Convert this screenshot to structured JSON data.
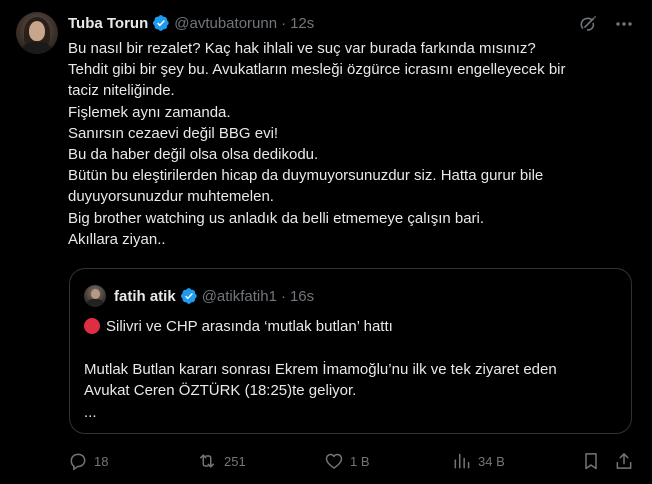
{
  "colors": {
    "background": "#000000",
    "text_primary": "#e7e9ea",
    "text_secondary": "#71767b",
    "verified_blue": "#1d9bf0",
    "border": "#2f3336",
    "red_dot": "#dd2e44"
  },
  "author": {
    "display_name": "Tuba Torun",
    "handle": "@avtubatorunn",
    "separator": "·",
    "time": "12s",
    "verified": true,
    "avatar_icon": "user-avatar"
  },
  "top_icons": [
    "grok-icon",
    "more-icon"
  ],
  "tweet_lines": [
    "Bu nasıl bir rezalet? Kaç hak ihlali ve suç var burada farkında mısınız?",
    "Tehdit gibi bir şey bu. Avukatların mesleği özgürce icrasını engelleyecek bir",
    "taciz niteliğinde.",
    "Fişlemek aynı zamanda.",
    "Sanırsın cezaevi değil BBG evi!",
    "Bu da haber değil olsa olsa dedikodu.",
    "Bütün bu eleştirilerden hicap da duymuyorsunuzdur siz. Hatta gurur bile",
    "duyuyorsunuzdur muhtemelen.",
    "Big brother watching us anladık da belli etmemeye çalışın bari.",
    "Akıllara ziyan.."
  ],
  "quote": {
    "display_name": "fatih atik",
    "handle": "@atikfatih1",
    "separator": "·",
    "time": "16s",
    "verified": true,
    "lines": [
      "Silivri ve CHP arasında ‘mutlak butlan’ hattı",
      "",
      "Mutlak Butlan kararı sonrası Ekrem İmamoğlu’nu ilk ve tek ziyaret eden",
      "Avukat Ceren ÖZTÜRK (18:25)te geliyor.",
      "..."
    ]
  },
  "actions": {
    "replies": "18",
    "reposts": "251",
    "likes": "1 B",
    "views": "34 B"
  }
}
